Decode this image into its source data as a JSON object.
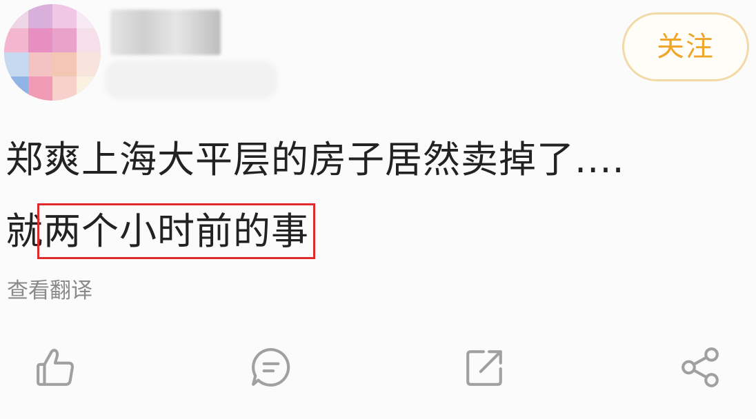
{
  "colors": {
    "accent": "#f0a62b",
    "accent_border": "#f3d9a6",
    "highlight_box": "#e0292b",
    "text": "#222222",
    "muted": "#8a8a8a",
    "icon": "#a0a0a0",
    "background": "#fbfbfb"
  },
  "header": {
    "follow_label": "关注"
  },
  "post": {
    "line1": "郑爽上海大平层的房子居然卖掉了....",
    "line2_prefix": "就",
    "line2_highlight": "两个小时前的事"
  },
  "translate_label": "查看翻译",
  "actions": [
    {
      "icon": "thumbs-up-icon"
    },
    {
      "icon": "comment-icon"
    },
    {
      "icon": "repost-icon"
    },
    {
      "icon": "share-icon"
    }
  ]
}
